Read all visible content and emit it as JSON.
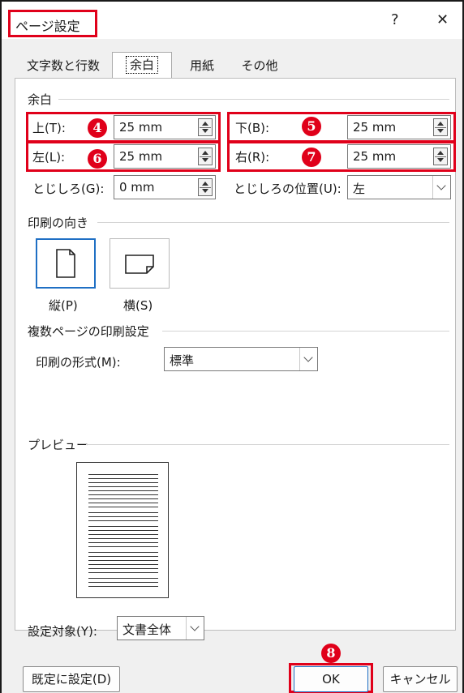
{
  "window": {
    "title": "ページ設定",
    "help_label": "?",
    "close_label": "✕"
  },
  "tabs": [
    {
      "label": "文字数と行数"
    },
    {
      "label": "余白"
    },
    {
      "label": "用紙"
    },
    {
      "label": "その他"
    }
  ],
  "margins": {
    "section_label": "余白",
    "top": {
      "label": "上(T):",
      "value": "25 mm",
      "badge": "4"
    },
    "bottom": {
      "label": "下(B):",
      "value": "25 mm",
      "badge": "5"
    },
    "left": {
      "label": "左(L):",
      "value": "25 mm",
      "badge": "6"
    },
    "right": {
      "label": "右(R):",
      "value": "25 mm",
      "badge": "7"
    },
    "gutter": {
      "label": "とじしろ(G):",
      "value": "0 mm"
    },
    "gutter_pos": {
      "label": "とじしろの位置(U):",
      "value": "左"
    }
  },
  "orientation": {
    "section_label": "印刷の向き",
    "portrait_label": "縦(P)",
    "landscape_label": "横(S)",
    "selected": "portrait"
  },
  "pages": {
    "section_label": "複数ページの印刷設定",
    "format_label": "印刷の形式(M):",
    "format_value": "標準"
  },
  "preview": {
    "section_label": "プレビュー"
  },
  "apply": {
    "label": "設定対象(Y):",
    "value": "文書全体"
  },
  "footer": {
    "default_label": "既定に設定(D)",
    "ok_label": "OK",
    "ok_badge": "8",
    "cancel_label": "キャンセル"
  },
  "colors": {
    "highlight": "#e0001a",
    "selection": "#1f6fc4"
  }
}
